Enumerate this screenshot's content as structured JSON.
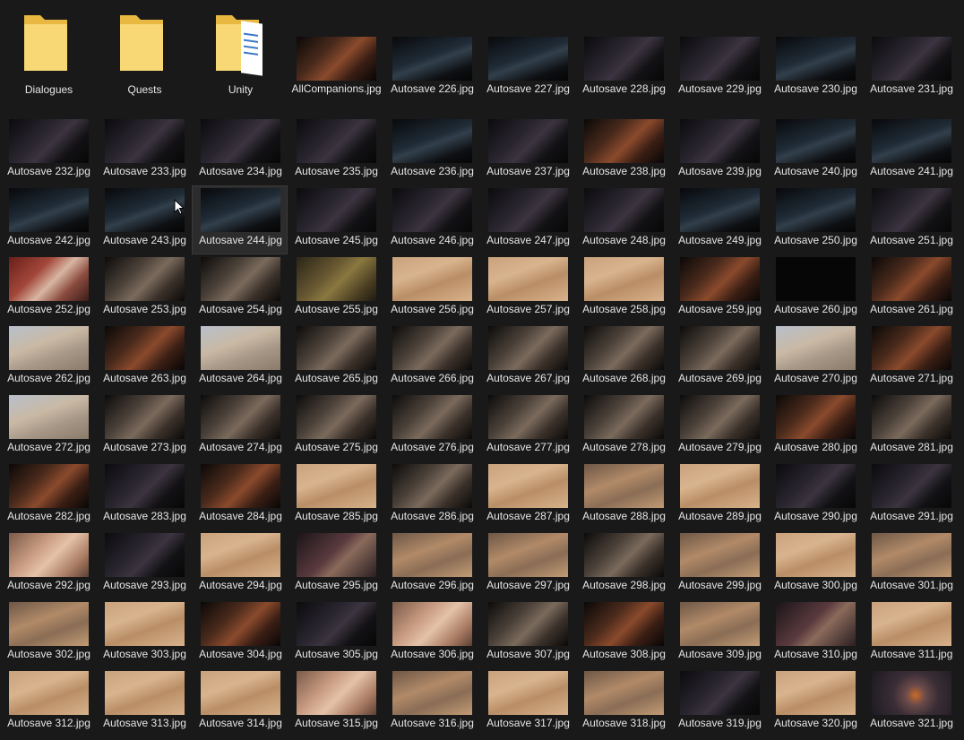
{
  "folders": [
    {
      "name": "Dialogues",
      "icon": "folder-icon"
    },
    {
      "name": "Quests",
      "icon": "folder-icon"
    },
    {
      "name": "Unity",
      "icon": "folder-documents-icon"
    }
  ],
  "files": [
    {
      "name": "AllCompanions.jpg",
      "tone": "warm"
    },
    {
      "name": "Autosave 226.jpg",
      "tone": "darkb"
    },
    {
      "name": "Autosave 227.jpg",
      "tone": "darkb"
    },
    {
      "name": "Autosave 228.jpg",
      "tone": "dark"
    },
    {
      "name": "Autosave 229.jpg",
      "tone": "dark"
    },
    {
      "name": "Autosave 230.jpg",
      "tone": "darkb"
    },
    {
      "name": "Autosave 231.jpg",
      "tone": "dark"
    },
    {
      "name": "Autosave 232.jpg",
      "tone": "dark"
    },
    {
      "name": "Autosave 233.jpg",
      "tone": "dark"
    },
    {
      "name": "Autosave 234.jpg",
      "tone": "dark"
    },
    {
      "name": "Autosave 235.jpg",
      "tone": "dark"
    },
    {
      "name": "Autosave 236.jpg",
      "tone": "darkb"
    },
    {
      "name": "Autosave 237.jpg",
      "tone": "dark"
    },
    {
      "name": "Autosave 238.jpg",
      "tone": "warm"
    },
    {
      "name": "Autosave 239.jpg",
      "tone": "dark"
    },
    {
      "name": "Autosave 240.jpg",
      "tone": "darkb"
    },
    {
      "name": "Autosave 241.jpg",
      "tone": "darkb"
    },
    {
      "name": "Autosave 242.jpg",
      "tone": "darkb"
    },
    {
      "name": "Autosave 243.jpg",
      "tone": "darkb"
    },
    {
      "name": "Autosave 244.jpg",
      "tone": "darkb"
    },
    {
      "name": "Autosave 245.jpg",
      "tone": "dark"
    },
    {
      "name": "Autosave 246.jpg",
      "tone": "dark"
    },
    {
      "name": "Autosave 247.jpg",
      "tone": "dark"
    },
    {
      "name": "Autosave 248.jpg",
      "tone": "dark"
    },
    {
      "name": "Autosave 249.jpg",
      "tone": "darkb"
    },
    {
      "name": "Autosave 250.jpg",
      "tone": "darkb"
    },
    {
      "name": "Autosave 251.jpg",
      "tone": "dark"
    },
    {
      "name": "Autosave 252.jpg",
      "tone": "char"
    },
    {
      "name": "Autosave 253.jpg",
      "tone": "stone"
    },
    {
      "name": "Autosave 254.jpg",
      "tone": "stone"
    },
    {
      "name": "Autosave 255.jpg",
      "tone": "green"
    },
    {
      "name": "Autosave 256.jpg",
      "tone": "sand"
    },
    {
      "name": "Autosave 257.jpg",
      "tone": "sand"
    },
    {
      "name": "Autosave 258.jpg",
      "tone": "sand"
    },
    {
      "name": "Autosave 259.jpg",
      "tone": "warm"
    },
    {
      "name": "Autosave 260.jpg",
      "tone": "black"
    },
    {
      "name": "Autosave 261.jpg",
      "tone": "warm"
    },
    {
      "name": "Autosave 262.jpg",
      "tone": "light"
    },
    {
      "name": "Autosave 263.jpg",
      "tone": "warm"
    },
    {
      "name": "Autosave 264.jpg",
      "tone": "light"
    },
    {
      "name": "Autosave 265.jpg",
      "tone": "stone"
    },
    {
      "name": "Autosave 266.jpg",
      "tone": "stone"
    },
    {
      "name": "Autosave 267.jpg",
      "tone": "stone"
    },
    {
      "name": "Autosave 268.jpg",
      "tone": "stone"
    },
    {
      "name": "Autosave 269.jpg",
      "tone": "stone"
    },
    {
      "name": "Autosave 270.jpg",
      "tone": "light"
    },
    {
      "name": "Autosave 271.jpg",
      "tone": "warm"
    },
    {
      "name": "Autosave 272.jpg",
      "tone": "light"
    },
    {
      "name": "Autosave 273.jpg",
      "tone": "stone"
    },
    {
      "name": "Autosave 274.jpg",
      "tone": "stone"
    },
    {
      "name": "Autosave 275.jpg",
      "tone": "stone"
    },
    {
      "name": "Autosave 276.jpg",
      "tone": "stone"
    },
    {
      "name": "Autosave 277.jpg",
      "tone": "stone"
    },
    {
      "name": "Autosave 278.jpg",
      "tone": "stone"
    },
    {
      "name": "Autosave 279.jpg",
      "tone": "stone"
    },
    {
      "name": "Autosave 280.jpg",
      "tone": "warm"
    },
    {
      "name": "Autosave 281.jpg",
      "tone": "stone"
    },
    {
      "name": "Autosave 282.jpg",
      "tone": "warm"
    },
    {
      "name": "Autosave 283.jpg",
      "tone": "dark"
    },
    {
      "name": "Autosave 284.jpg",
      "tone": "warm"
    },
    {
      "name": "Autosave 285.jpg",
      "tone": "sand"
    },
    {
      "name": "Autosave 286.jpg",
      "tone": "stone"
    },
    {
      "name": "Autosave 287.jpg",
      "tone": "sand"
    },
    {
      "name": "Autosave 288.jpg",
      "tone": "sanddk"
    },
    {
      "name": "Autosave 289.jpg",
      "tone": "sand"
    },
    {
      "name": "Autosave 290.jpg",
      "tone": "dark"
    },
    {
      "name": "Autosave 291.jpg",
      "tone": "dark"
    },
    {
      "name": "Autosave 292.jpg",
      "tone": "skin"
    },
    {
      "name": "Autosave 293.jpg",
      "tone": "dark"
    },
    {
      "name": "Autosave 294.jpg",
      "tone": "sand"
    },
    {
      "name": "Autosave 295.jpg",
      "tone": "night"
    },
    {
      "name": "Autosave 296.jpg",
      "tone": "sanddk"
    },
    {
      "name": "Autosave 297.jpg",
      "tone": "sanddk"
    },
    {
      "name": "Autosave 298.jpg",
      "tone": "stone"
    },
    {
      "name": "Autosave 299.jpg",
      "tone": "sanddk"
    },
    {
      "name": "Autosave 300.jpg",
      "tone": "sand"
    },
    {
      "name": "Autosave 301.jpg",
      "tone": "sanddk"
    },
    {
      "name": "Autosave 302.jpg",
      "tone": "sanddk"
    },
    {
      "name": "Autosave 303.jpg",
      "tone": "sand"
    },
    {
      "name": "Autosave 304.jpg",
      "tone": "warm"
    },
    {
      "name": "Autosave 305.jpg",
      "tone": "dark"
    },
    {
      "name": "Autosave 306.jpg",
      "tone": "skin"
    },
    {
      "name": "Autosave 307.jpg",
      "tone": "stone"
    },
    {
      "name": "Autosave 308.jpg",
      "tone": "warm"
    },
    {
      "name": "Autosave 309.jpg",
      "tone": "sanddk"
    },
    {
      "name": "Autosave 310.jpg",
      "tone": "night"
    },
    {
      "name": "Autosave 311.jpg",
      "tone": "sand"
    },
    {
      "name": "Autosave 312.jpg",
      "tone": "sand"
    },
    {
      "name": "Autosave 313.jpg",
      "tone": "sand"
    },
    {
      "name": "Autosave 314.jpg",
      "tone": "sand"
    },
    {
      "name": "Autosave 315.jpg",
      "tone": "skin"
    },
    {
      "name": "Autosave 316.jpg",
      "tone": "sanddk"
    },
    {
      "name": "Autosave 317.jpg",
      "tone": "sand"
    },
    {
      "name": "Autosave 318.jpg",
      "tone": "sanddk"
    },
    {
      "name": "Autosave 319.jpg",
      "tone": "dark"
    },
    {
      "name": "Autosave 320.jpg",
      "tone": "sand"
    },
    {
      "name": "Autosave 321.jpg",
      "tone": "fire"
    }
  ],
  "hovered_file": "Autosave 244.jpg",
  "colors": {
    "background": "#191919",
    "text": "#e6e6e6",
    "hover_fill": "#2c2c2c",
    "folder_yellow": "#f8d775"
  }
}
